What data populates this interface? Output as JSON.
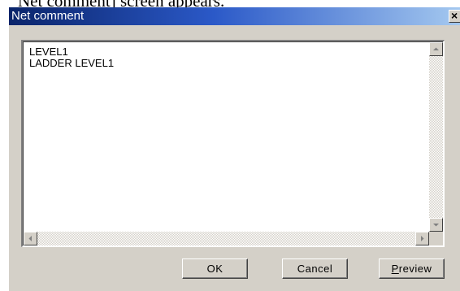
{
  "page_caption": "Net comment] screen appears.",
  "window": {
    "title": "Net comment",
    "close_label": "×"
  },
  "comment": {
    "lines": [
      "LEVEL1",
      "LADDER LEVEL1"
    ]
  },
  "buttons": {
    "ok_label": "OK",
    "cancel_label": "Cancel",
    "preview_mnemonic": "P",
    "preview_rest": "review"
  },
  "icons": {
    "scroll_up": "scroll-up-arrow-icon",
    "scroll_down": "scroll-down-arrow-icon",
    "scroll_left": "scroll-left-arrow-icon",
    "scroll_right": "scroll-right-arrow-icon"
  }
}
